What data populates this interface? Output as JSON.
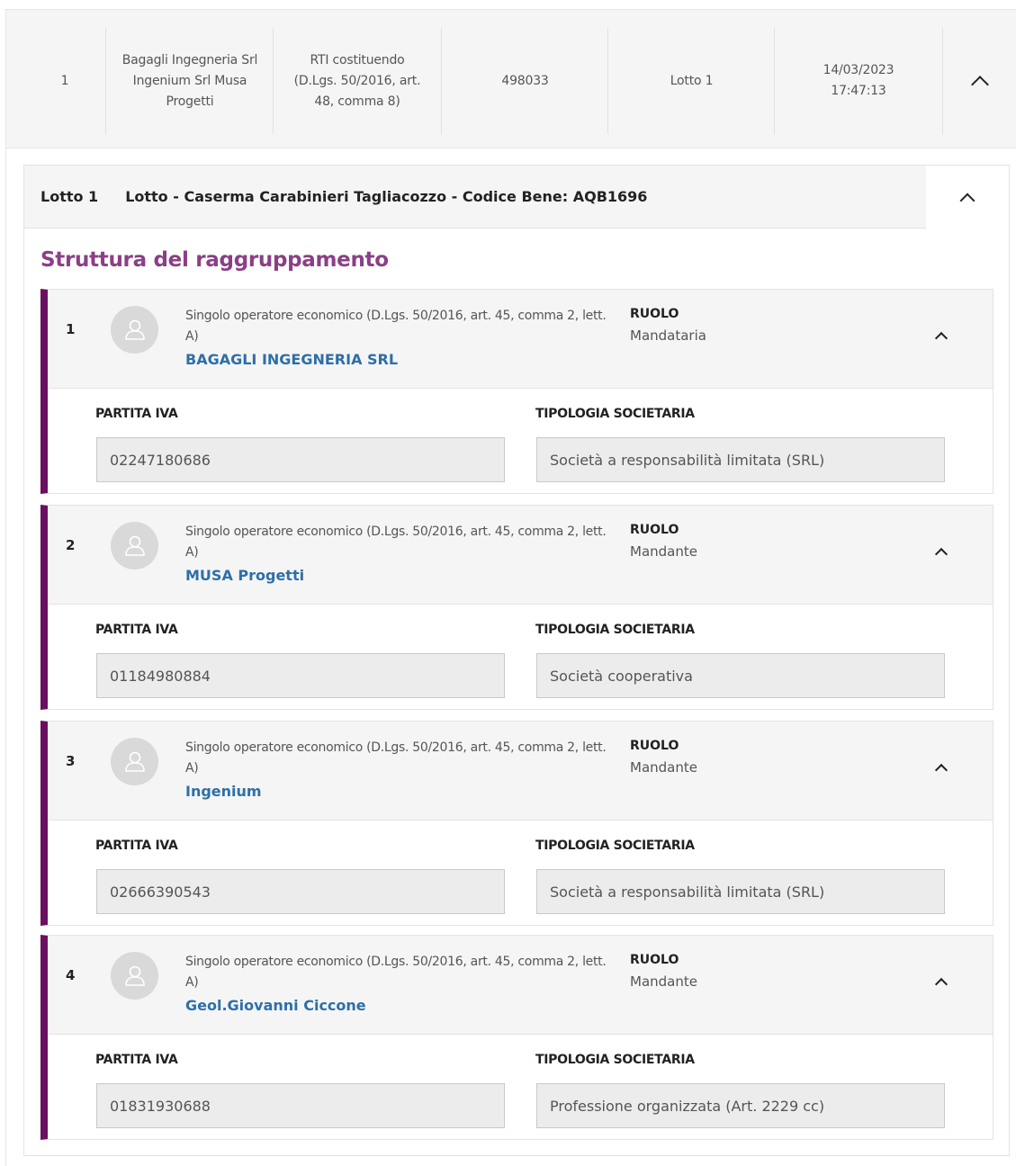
{
  "submission": {
    "number": "1",
    "operators": "Bagagli Ingegneria Srl Ingenium Srl Musa Progetti",
    "form": "RTI costituendo (D.Lgs. 50/2016, art. 48, comma 8)",
    "code": "498033",
    "lotto": "Lotto 1",
    "date": "14/03/2023",
    "time": "17:47:13"
  },
  "lotto_panel": {
    "number_label": "Lotto 1",
    "description": "Lotto - Caserma Carabinieri Tagliacozzo - Codice Bene: AQB1696"
  },
  "section_title": "Struttura del raggruppamento",
  "labels": {
    "ruolo": "RUOLO",
    "partita_iva": "PARTITA IVA",
    "tipologia": "TIPOLOGIA SOCIETARIA"
  },
  "members": [
    {
      "index": "1",
      "type": "Singolo operatore economico (D.Lgs. 50/2016, art. 45, comma 2, lett. A)",
      "name": "BAGAGLI INGEGNERIA SRL",
      "ruolo": "Mandataria",
      "partita_iva": "02247180686",
      "tipologia": "Società a responsabilità limitata (SRL)"
    },
    {
      "index": "2",
      "type": "Singolo operatore economico (D.Lgs. 50/2016, art. 45, comma 2, lett. A)",
      "name": "MUSA Progetti",
      "ruolo": "Mandante",
      "partita_iva": "01184980884",
      "tipologia": "Società cooperativa"
    },
    {
      "index": "3",
      "type": "Singolo operatore economico (D.Lgs. 50/2016, art. 45, comma 2, lett. A)",
      "name": "Ingenium",
      "ruolo": "Mandante",
      "partita_iva": "02666390543",
      "tipologia": "Società a responsabilità limitata (SRL)"
    },
    {
      "index": "4",
      "type": "Singolo operatore economico (D.Lgs. 50/2016, art. 45, comma 2, lett. A)",
      "name": "Geol.Giovanni Ciccone",
      "ruolo": "Mandante",
      "partita_iva": "01831930688",
      "tipologia": "Professione organizzata (Art. 2229 cc)"
    }
  ],
  "icons": {
    "collapse": "chevron-up-icon",
    "avatar": "user-icon"
  },
  "colors": {
    "accent_bar": "#6b0f61",
    "section_title": "#8b3f86",
    "link": "#2d6fa8"
  }
}
